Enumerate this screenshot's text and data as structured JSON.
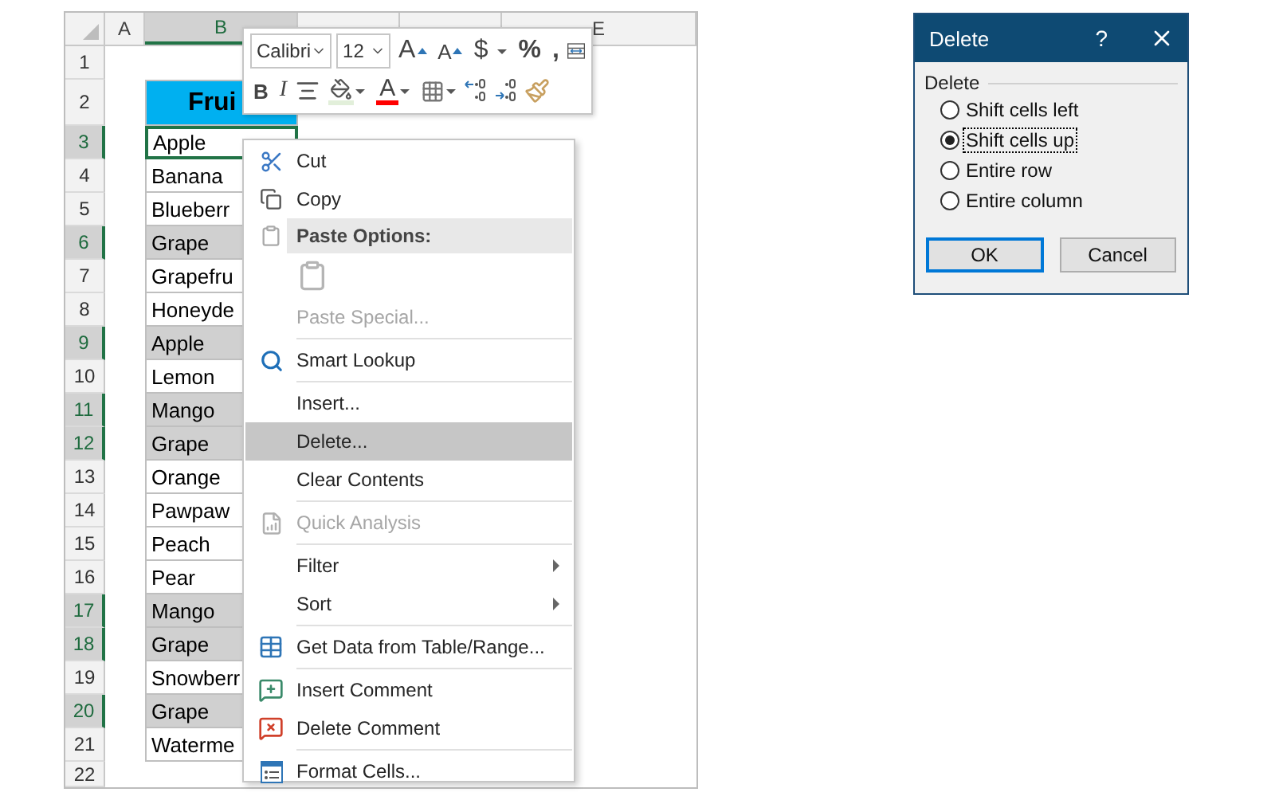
{
  "sheet": {
    "columns": [
      {
        "label": "A",
        "selected": false
      },
      {
        "label": "B",
        "selected": true
      },
      {
        "selected": false
      },
      {
        "selected": false
      },
      {
        "label": "E",
        "selected": false
      }
    ],
    "rows": [
      {
        "number": "1",
        "kind": "blank",
        "selected": false
      },
      {
        "number": "2",
        "kind": "header",
        "selected": false,
        "cell": "Frui"
      },
      {
        "number": "3",
        "kind": "data",
        "selected": true,
        "active": true,
        "cell": "Apple"
      },
      {
        "number": "4",
        "kind": "data",
        "selected": false,
        "active": false,
        "cell": "Banana"
      },
      {
        "number": "5",
        "kind": "data",
        "selected": false,
        "active": false,
        "cell": "Blueberr"
      },
      {
        "number": "6",
        "kind": "data",
        "selected": true,
        "active": false,
        "cell": "Grape"
      },
      {
        "number": "7",
        "kind": "data",
        "selected": false,
        "active": false,
        "cell": "Grapefru"
      },
      {
        "number": "8",
        "kind": "data",
        "selected": false,
        "active": false,
        "cell": "Honeyde"
      },
      {
        "number": "9",
        "kind": "data",
        "selected": true,
        "active": false,
        "cell": "Apple"
      },
      {
        "number": "10",
        "kind": "data",
        "selected": false,
        "active": false,
        "cell": "Lemon"
      },
      {
        "number": "11",
        "kind": "data",
        "selected": true,
        "active": false,
        "cell": "Mango"
      },
      {
        "number": "12",
        "kind": "data",
        "selected": true,
        "active": false,
        "cell": "Grape"
      },
      {
        "number": "13",
        "kind": "data",
        "selected": false,
        "active": false,
        "cell": "Orange"
      },
      {
        "number": "14",
        "kind": "data",
        "selected": false,
        "active": false,
        "cell": "Pawpaw"
      },
      {
        "number": "15",
        "kind": "data",
        "selected": false,
        "active": false,
        "cell": "Peach"
      },
      {
        "number": "16",
        "kind": "data",
        "selected": false,
        "active": false,
        "cell": "Pear"
      },
      {
        "number": "17",
        "kind": "data",
        "selected": true,
        "active": false,
        "cell": "Mango"
      },
      {
        "number": "18",
        "kind": "data",
        "selected": true,
        "active": false,
        "cell": "Grape"
      },
      {
        "number": "19",
        "kind": "data",
        "selected": false,
        "active": false,
        "cell": "Snowberr"
      },
      {
        "number": "20",
        "kind": "data",
        "selected": true,
        "active": false,
        "cell": "Grape"
      },
      {
        "number": "21",
        "kind": "data",
        "selected": false,
        "active": false,
        "cell": "Waterme"
      },
      {
        "number": "22",
        "kind": "blank",
        "selected": false
      }
    ]
  },
  "mini_toolbar": {
    "font": "Calibri",
    "size": "12",
    "row_1": [
      {
        "kind": "grow",
        "label": "A"
      },
      {
        "kind": "shrink",
        "label": "A"
      },
      {
        "kind": "text-dropdown",
        "label": "$"
      },
      {
        "kind": "text",
        "label": "%"
      },
      {
        "kind": "text",
        "label": ","
      },
      {
        "kind": "wrap"
      }
    ],
    "row_2": [
      {
        "kind": "bold",
        "label": "B"
      },
      {
        "kind": "italic",
        "label": "I"
      },
      {
        "kind": "align"
      },
      {
        "kind": "fill",
        "color": "#e2efda"
      },
      {
        "kind": "font-color",
        "label": "A",
        "color": "#ff0000"
      },
      {
        "kind": "borders"
      },
      {
        "kind": "decrease-decimal"
      },
      {
        "kind": "increase-decimal"
      },
      {
        "kind": "painter"
      }
    ]
  },
  "menu": {
    "items": [
      {
        "kind": "item",
        "label": "Cut",
        "disabled": false,
        "highlighted": false,
        "submenu": false
      },
      {
        "kind": "item",
        "label": "Copy",
        "disabled": false,
        "highlighted": false,
        "submenu": false
      },
      {
        "kind": "header",
        "label": "Paste Options:"
      },
      {
        "kind": "paste-row"
      },
      {
        "kind": "item",
        "label": "Paste Special...",
        "disabled": true,
        "highlighted": false,
        "submenu": false
      },
      {
        "kind": "separator"
      },
      {
        "kind": "item",
        "label": "Smart Lookup",
        "disabled": false,
        "highlighted": false,
        "submenu": false
      },
      {
        "kind": "separator"
      },
      {
        "kind": "item",
        "label": "Insert...",
        "disabled": false,
        "highlighted": false,
        "submenu": false
      },
      {
        "kind": "item",
        "label": "Delete...",
        "disabled": false,
        "highlighted": true,
        "submenu": false
      },
      {
        "kind": "item",
        "label": "Clear Contents",
        "disabled": false,
        "highlighted": false,
        "submenu": false
      },
      {
        "kind": "separator"
      },
      {
        "kind": "item",
        "label": "Quick Analysis",
        "disabled": true,
        "highlighted": false,
        "submenu": false
      },
      {
        "kind": "separator"
      },
      {
        "kind": "item",
        "label": "Filter",
        "disabled": false,
        "highlighted": false,
        "submenu": true
      },
      {
        "kind": "item",
        "label": "Sort",
        "disabled": false,
        "highlighted": false,
        "submenu": true
      },
      {
        "kind": "separator"
      },
      {
        "kind": "item",
        "label": "Get Data from Table/Range...",
        "disabled": false,
        "highlighted": false,
        "submenu": false
      },
      {
        "kind": "separator"
      },
      {
        "kind": "item",
        "label": "Insert Comment",
        "disabled": false,
        "highlighted": false,
        "submenu": false
      },
      {
        "kind": "item",
        "label": "Delete Comment",
        "disabled": false,
        "highlighted": false,
        "submenu": false
      },
      {
        "kind": "separator"
      },
      {
        "kind": "item",
        "label": "Format Cells...",
        "disabled": false,
        "highlighted": false,
        "submenu": false
      }
    ]
  },
  "dialog": {
    "title": "Delete",
    "help": "?",
    "group": "Delete",
    "options": [
      {
        "label": "Shift cells left",
        "selected": false
      },
      {
        "label": "Shift cells up",
        "selected": true
      },
      {
        "label": "Entire row",
        "selected": false
      },
      {
        "label": "Entire column",
        "selected": false
      }
    ],
    "buttons": [
      {
        "label": "OK",
        "default": true
      },
      {
        "label": "Cancel",
        "default": false
      }
    ]
  }
}
